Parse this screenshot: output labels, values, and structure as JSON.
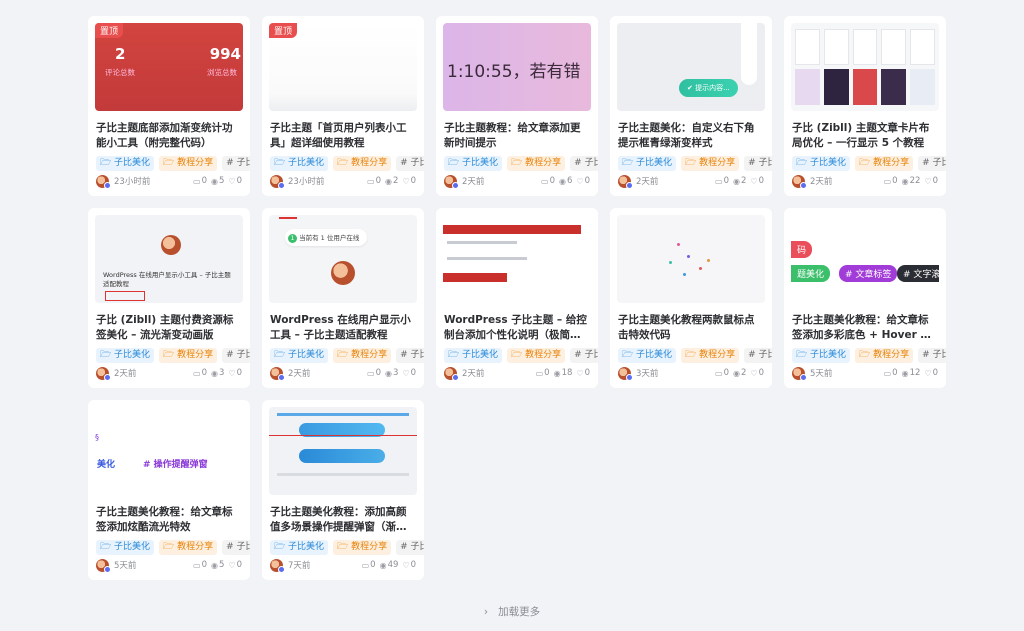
{
  "cards": [
    {
      "title": "子比主题底部添加渐变统计功能小工具（附完整代码）",
      "tags": [
        "子比美化",
        "教程分享",
        "子比"
      ],
      "time": "23小时前",
      "comments": "0",
      "views": "5",
      "likes": "0",
      "thumb": {
        "badge": "置顶",
        "n1": "2",
        "l1": "评论总数",
        "n2": "994",
        "l2": "浏览总数"
      }
    },
    {
      "title": "子比主题「首页用户列表小工具」超详细使用教程",
      "tags": [
        "子比美化",
        "教程分享",
        "子比"
      ],
      "time": "23小时前",
      "comments": "0",
      "views": "2",
      "likes": "0",
      "thumb": {
        "badge": "置顶"
      }
    },
    {
      "title": "子比主题教程：给文章添加更新时间提示",
      "tags": [
        "子比美化",
        "教程分享",
        "子比"
      ],
      "time": "2天前",
      "comments": "0",
      "views": "6",
      "likes": "0",
      "thumb": {
        "text": "1:10:55，若有错"
      }
    },
    {
      "title": "子比主题美化：自定义右下角提示框青绿渐变样式",
      "tags": [
        "子比美化",
        "教程分享",
        "子比"
      ],
      "time": "2天前",
      "comments": "0",
      "views": "2",
      "likes": "0",
      "thumb": {
        "toast": "提示内容..."
      }
    },
    {
      "title": "子比 (Zibll) 主题文章卡片布局优化 – 一行显示 5 个教程",
      "tags": [
        "子比美化",
        "教程分享",
        "子比"
      ],
      "time": "2天前",
      "comments": "0",
      "views": "22",
      "likes": "0",
      "thumb": {}
    },
    {
      "title": "子比 (Zibll) 主题付费资源标签美化 – 流光渐变动画版",
      "tags": [
        "子比美化",
        "教程分享",
        "子比"
      ],
      "time": "2天前",
      "comments": "0",
      "views": "3",
      "likes": "0",
      "thumb": {
        "caption": "WordPress 在线用户显示小工具 – 子比主题适配教程"
      }
    },
    {
      "title": "WordPress 在线用户显示小工具 – 子比主题适配教程",
      "tags": [
        "子比美化",
        "教程分享",
        "子比"
      ],
      "time": "2天前",
      "comments": "0",
      "views": "3",
      "likes": "0",
      "thumb": {
        "pill": "当前有 1 位用户在线"
      }
    },
    {
      "title": "WordPress 子比主题 – 给控制台添加个性化说明（极简纯色…",
      "tags": [
        "子比美化",
        "教程分享",
        "子比"
      ],
      "time": "2天前",
      "comments": "0",
      "views": "18",
      "likes": "0",
      "thumb": {}
    },
    {
      "title": "子比主题美化教程两款鼠标点击特效代码",
      "tags": [
        "子比美化",
        "教程分享",
        "子比"
      ],
      "time": "3天前",
      "comments": "0",
      "views": "2",
      "likes": "0",
      "thumb": {}
    },
    {
      "title": "子比主题美化教程：给文章标签添加多彩底色 + Hover 流光立…",
      "tags": [
        "子比美化",
        "教程分享",
        "子比"
      ],
      "time": "5天前",
      "comments": "0",
      "views": "12",
      "likes": "0",
      "thumb": {
        "t1": "码",
        "t2": "题美化",
        "t3": "# 文章标签",
        "t4": "# 文字滚"
      }
    },
    {
      "title": "子比主题美化教程：给文章标签添加炫酷流光特效",
      "tags": [
        "子比美化",
        "教程分享",
        "子比"
      ],
      "time": "5天前",
      "comments": "0",
      "views": "5",
      "likes": "0",
      "thumb": {
        "t1": "美化",
        "t2": "# 操作提醒弹窗"
      }
    },
    {
      "title": "子比主题美化教程：添加高颜值多场景操作提醒弹窗（渐变气…",
      "tags": [
        "子比美化",
        "教程分享",
        "子比"
      ],
      "time": "7天前",
      "comments": "0",
      "views": "49",
      "likes": "0",
      "thumb": {}
    }
  ],
  "load_more": "加载更多",
  "colors": {
    "blue_tag": "#2a8ad8",
    "orange_tag": "#e8840c",
    "badge": "#e94e4e"
  }
}
